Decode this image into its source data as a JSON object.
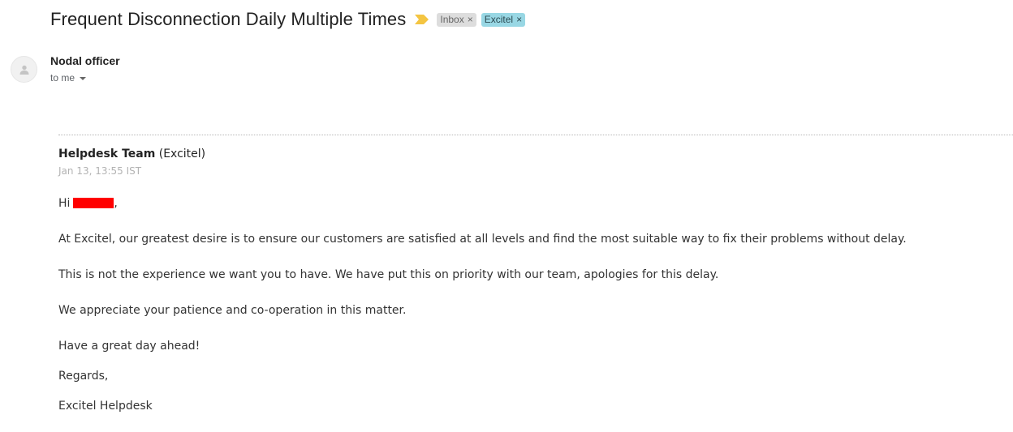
{
  "email": {
    "subject": "Frequent Disconnection Daily Multiple Times",
    "labels": [
      {
        "name": "Inbox",
        "color": "#dddddd"
      },
      {
        "name": "Excitel",
        "color": "#98d7e4"
      }
    ],
    "label_remove_glyph": "×",
    "sender_name": "Nodal officer",
    "recipient": "to me"
  },
  "message": {
    "agent_name": "Helpdesk Team",
    "agent_org": "(Excitel)",
    "timestamp": "Jan 13, 13:55 IST",
    "greeting": "Hi",
    "greeting_suffix": ",",
    "paragraphs": [
      "At Excitel, our greatest desire is to ensure our customers are satisfied at all levels and find the most suitable way to fix their problems without delay.",
      "This is not the experience we want you to have. We have put this on priority with our team, apologies for this delay.",
      "We appreciate your patience and co-operation in this matter.",
      "Have a great day ahead!",
      "Regards,",
      "Excitel Helpdesk"
    ]
  },
  "icons": {
    "importance": "importance-marker-icon",
    "avatar": "person-icon",
    "details": "chevron-down-icon"
  },
  "colors": {
    "redaction": "#ff0000",
    "importance": "#f4c542"
  }
}
